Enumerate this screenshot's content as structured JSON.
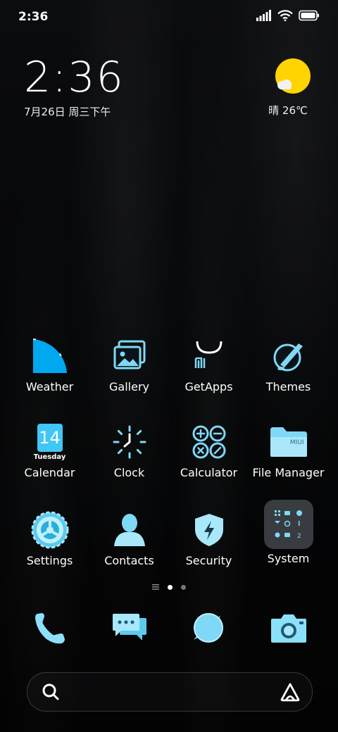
{
  "status_bar": {
    "time": "2:36",
    "icons": [
      "signal-icon",
      "wifi-icon",
      "battery-icon"
    ]
  },
  "clock_widget": {
    "time": "2:36",
    "date": "7月26日 周三下午"
  },
  "weather_widget": {
    "text": "晴 26℃",
    "icon": "sun-icon"
  },
  "apps": [
    {
      "label": "Weather",
      "icon": "weather-icon"
    },
    {
      "label": "Gallery",
      "icon": "gallery-icon"
    },
    {
      "label": "GetApps",
      "icon": "getapps-icon"
    },
    {
      "label": "Themes",
      "icon": "themes-icon"
    },
    {
      "label": "Calendar",
      "icon": "calendar-icon",
      "icon_day": "14",
      "icon_weekday": "Tuesday"
    },
    {
      "label": "Clock",
      "icon": "clock-icon"
    },
    {
      "label": "Calculator",
      "icon": "calculator-icon"
    },
    {
      "label": "File Manager",
      "icon": "file-manager-icon",
      "icon_text": "MIUI"
    },
    {
      "label": "Settings",
      "icon": "settings-icon"
    },
    {
      "label": "Contacts",
      "icon": "contacts-icon"
    },
    {
      "label": "Security",
      "icon": "security-icon"
    },
    {
      "label": "System",
      "icon": "system-folder-icon"
    }
  ],
  "page_indicator": {
    "pages": 2,
    "active": 1
  },
  "dock": [
    {
      "icon": "phone-icon"
    },
    {
      "icon": "messages-icon"
    },
    {
      "icon": "browser-icon"
    },
    {
      "icon": "camera-icon"
    }
  ],
  "search": {
    "icon": "search-icon",
    "assistant_icon": "assistant-icon"
  },
  "colors": {
    "accent": "#7fd8f6",
    "weather_blue": "#00a8f0",
    "sun": "#ffd400"
  }
}
